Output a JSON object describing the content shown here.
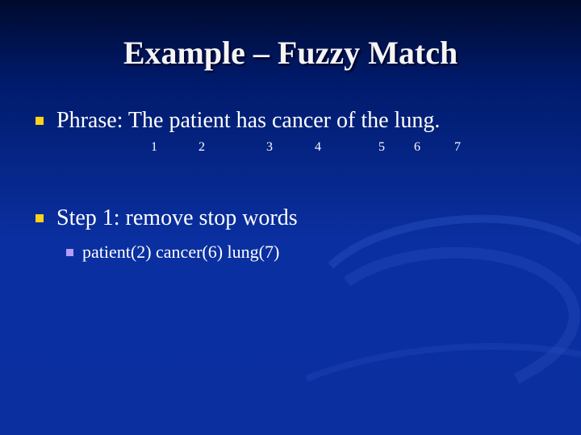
{
  "slide": {
    "title": "Example – Fuzzy Match",
    "bullets": [
      {
        "text": "Phrase: The patient has cancer of the lung."
      },
      {
        "text": "Step 1: remove stop words"
      }
    ],
    "sub_bullets": [
      {
        "text": "patient(2) cancer(6) lung(7)"
      }
    ],
    "word_numbers": [
      "1",
      "2",
      "3",
      "4",
      "5",
      "6",
      "7"
    ]
  },
  "colors": {
    "bullet_primary": "#ffd21a",
    "bullet_secondary": "#b49cff",
    "background": "#0b2f9f"
  }
}
